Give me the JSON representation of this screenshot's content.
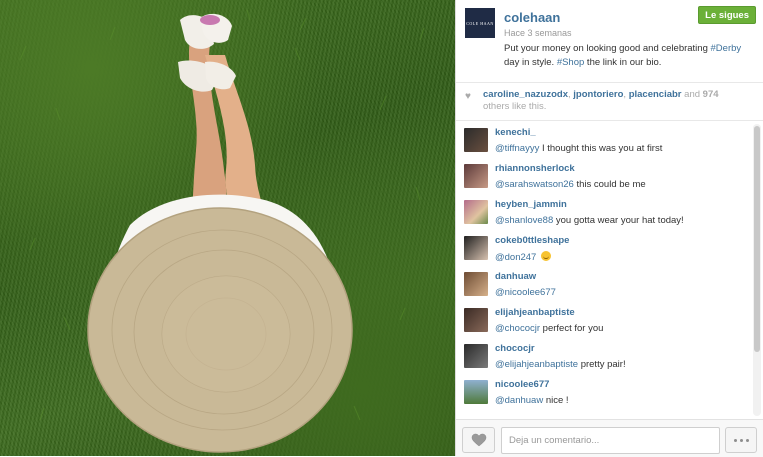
{
  "post": {
    "username": "colehaan",
    "brand_mark": "COLE HAAN",
    "timestamp": "Hace 3 semanas",
    "follow_label": "Le sigues",
    "caption": {
      "line1": "Put your money on looking good and celebrating",
      "tag1": "#Derby",
      "mid": " day in style. ",
      "tag2": "#Shop",
      "end": " the link in our bio."
    }
  },
  "likes": {
    "users": [
      "caroline_nazuzodx",
      "jpontoriero",
      "placenciabr"
    ],
    "joiner": "and",
    "count": "974",
    "suffix": "others like this."
  },
  "comments": [
    {
      "user": "kenechi_",
      "mention": "@tiffnayyy",
      "text": " I thought this was you at first"
    },
    {
      "user": "rhiannonsherlock",
      "mention": "@sarahswatson26",
      "text": " this could be me"
    },
    {
      "user": "heyben_jammin",
      "mention": "@shanlove88",
      "text": " you gotta wear your hat today!"
    },
    {
      "user": "cokeb0ttleshape",
      "mention": "@don247",
      "text": " ",
      "emoji": "smile"
    },
    {
      "user": "danhuaw",
      "mention": "@nicoolee677",
      "text": ""
    },
    {
      "user": "elijahjeanbaptiste",
      "mention": "@chococjr",
      "text": " perfect for you"
    },
    {
      "user": "chococjr",
      "mention": "@elijahjeanbaptiste",
      "text": " pretty pair!"
    },
    {
      "user": "nicoolee677",
      "mention": "@danhuaw",
      "text": " nice !"
    }
  ],
  "footer": {
    "comment_placeholder": "Deja un comentario..."
  },
  "icons": {
    "like": "heart-icon",
    "more": "ellipsis-icon"
  },
  "colors": {
    "link": "#3f729b",
    "follow": "#6bb038"
  }
}
